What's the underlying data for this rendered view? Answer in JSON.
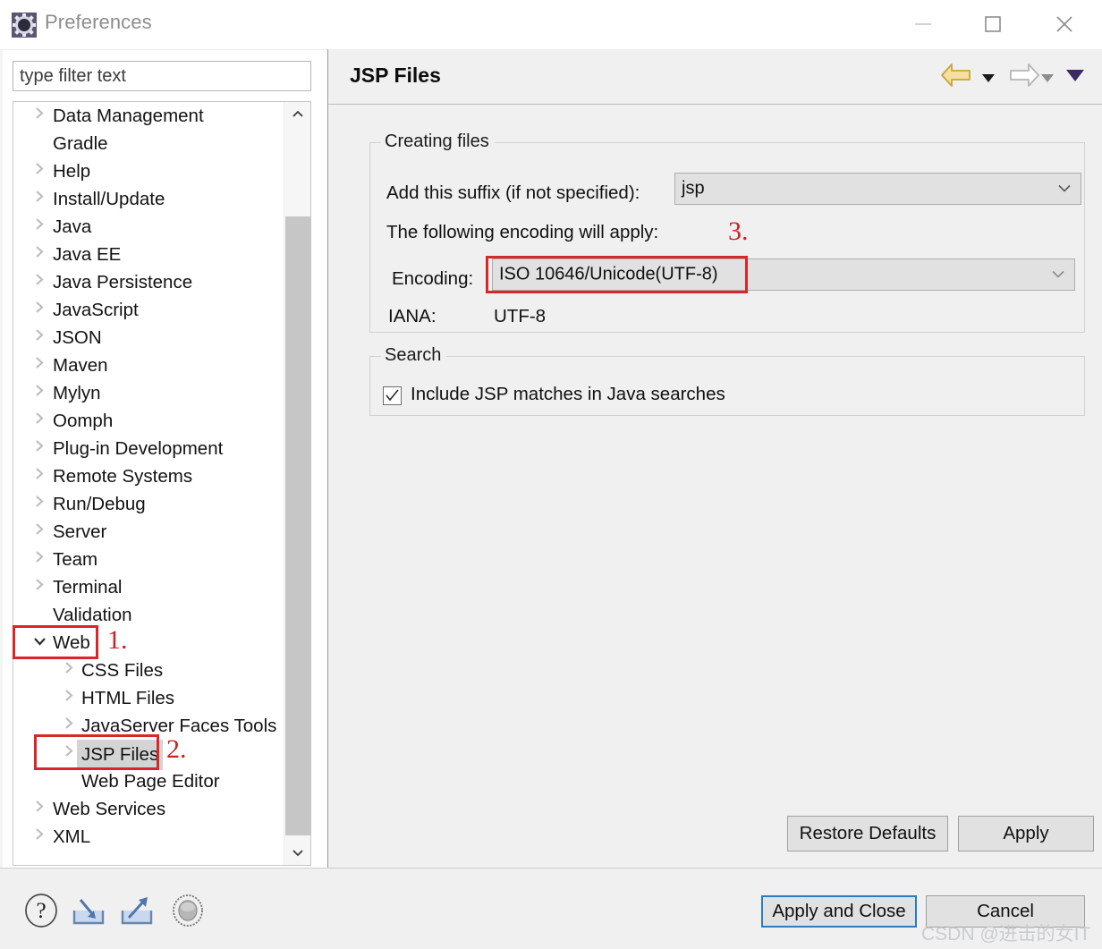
{
  "window": {
    "title": "Preferences",
    "icon": "preferences-gear-icon",
    "minimize_label": "Minimize",
    "maximize_label": "Maximize",
    "close_label": "Close"
  },
  "filter": {
    "placeholder": "type filter text",
    "value": ""
  },
  "tree": {
    "items": [
      {
        "label": "Data Management",
        "level": 0,
        "twisty": "chevron-right",
        "selected": false
      },
      {
        "label": "Gradle",
        "level": 0,
        "twisty": "none",
        "selected": false
      },
      {
        "label": "Help",
        "level": 0,
        "twisty": "chevron-right",
        "selected": false
      },
      {
        "label": "Install/Update",
        "level": 0,
        "twisty": "chevron-right",
        "selected": false
      },
      {
        "label": "Java",
        "level": 0,
        "twisty": "chevron-right",
        "selected": false
      },
      {
        "label": "Java EE",
        "level": 0,
        "twisty": "chevron-right",
        "selected": false
      },
      {
        "label": "Java Persistence",
        "level": 0,
        "twisty": "chevron-right",
        "selected": false
      },
      {
        "label": "JavaScript",
        "level": 0,
        "twisty": "chevron-right",
        "selected": false
      },
      {
        "label": "JSON",
        "level": 0,
        "twisty": "chevron-right",
        "selected": false
      },
      {
        "label": "Maven",
        "level": 0,
        "twisty": "chevron-right",
        "selected": false
      },
      {
        "label": "Mylyn",
        "level": 0,
        "twisty": "chevron-right",
        "selected": false
      },
      {
        "label": "Oomph",
        "level": 0,
        "twisty": "chevron-right",
        "selected": false
      },
      {
        "label": "Plug-in Development",
        "level": 0,
        "twisty": "chevron-right",
        "selected": false
      },
      {
        "label": "Remote Systems",
        "level": 0,
        "twisty": "chevron-right",
        "selected": false
      },
      {
        "label": "Run/Debug",
        "level": 0,
        "twisty": "chevron-right",
        "selected": false
      },
      {
        "label": "Server",
        "level": 0,
        "twisty": "chevron-right",
        "selected": false
      },
      {
        "label": "Team",
        "level": 0,
        "twisty": "chevron-right",
        "selected": false
      },
      {
        "label": "Terminal",
        "level": 0,
        "twisty": "chevron-right",
        "selected": false
      },
      {
        "label": "Validation",
        "level": 0,
        "twisty": "none",
        "selected": false
      },
      {
        "label": "Web",
        "level": 0,
        "twisty": "chevron-down",
        "selected": false
      },
      {
        "label": "CSS Files",
        "level": 1,
        "twisty": "chevron-right",
        "selected": false
      },
      {
        "label": "HTML Files",
        "level": 1,
        "twisty": "chevron-right",
        "selected": false
      },
      {
        "label": "JavaServer Faces Tools",
        "level": 1,
        "twisty": "chevron-right",
        "selected": false
      },
      {
        "label": "JSP Files",
        "level": 1,
        "twisty": "chevron-right",
        "selected": true
      },
      {
        "label": "Web Page Editor",
        "level": 1,
        "twisty": "none",
        "selected": false
      },
      {
        "label": "Web Services",
        "level": 0,
        "twisty": "chevron-right",
        "selected": false
      },
      {
        "label": "XML",
        "level": 0,
        "twisty": "chevron-right",
        "selected": false
      }
    ],
    "scrollbar": {
      "up_icon": "chevron-up-icon",
      "down_icon": "chevron-down-icon"
    }
  },
  "page": {
    "title": "JSP Files",
    "header_icons": {
      "back": "back-arrow-icon",
      "back_menu": "caret-down-icon",
      "forward": "forward-arrow-icon",
      "forward_menu": "caret-down-icon",
      "menu": "view-menu-caret-icon"
    },
    "creating_files": {
      "group_label": "Creating files",
      "suffix_label": "Add this suffix (if not specified):",
      "suffix_value": "jsp",
      "encoding_intro_label": "The following encoding will apply:",
      "encoding_label": "Encoding:",
      "encoding_value": "ISO 10646/Unicode(UTF-8)",
      "iana_label": "IANA:",
      "iana_value": "UTF-8"
    },
    "search": {
      "group_label": "Search",
      "checkbox_label": "Include JSP matches in Java searches",
      "checkbox_checked": true
    },
    "restore_defaults_label": "Restore Defaults",
    "apply_label": "Apply"
  },
  "annotations": {
    "step1": "1.",
    "step2": "2.",
    "step3": "3.",
    "color": "#d62828"
  },
  "footer": {
    "help_icon": "help-question-icon",
    "import_icon": "import-arrow-icon",
    "export_icon": "export-arrow-icon",
    "record_icon": "record-circle-icon",
    "apply_and_close_label": "Apply and Close",
    "cancel_label": "Cancel",
    "watermark": "CSDN @进击的女IT"
  },
  "colors": {
    "panel_bg": "#f0f0f0",
    "accent_focus": "#2b7cc0",
    "selection": "#d4d4d4",
    "annotation_red": "#d62828",
    "back_arrow": "#f2d98b"
  }
}
